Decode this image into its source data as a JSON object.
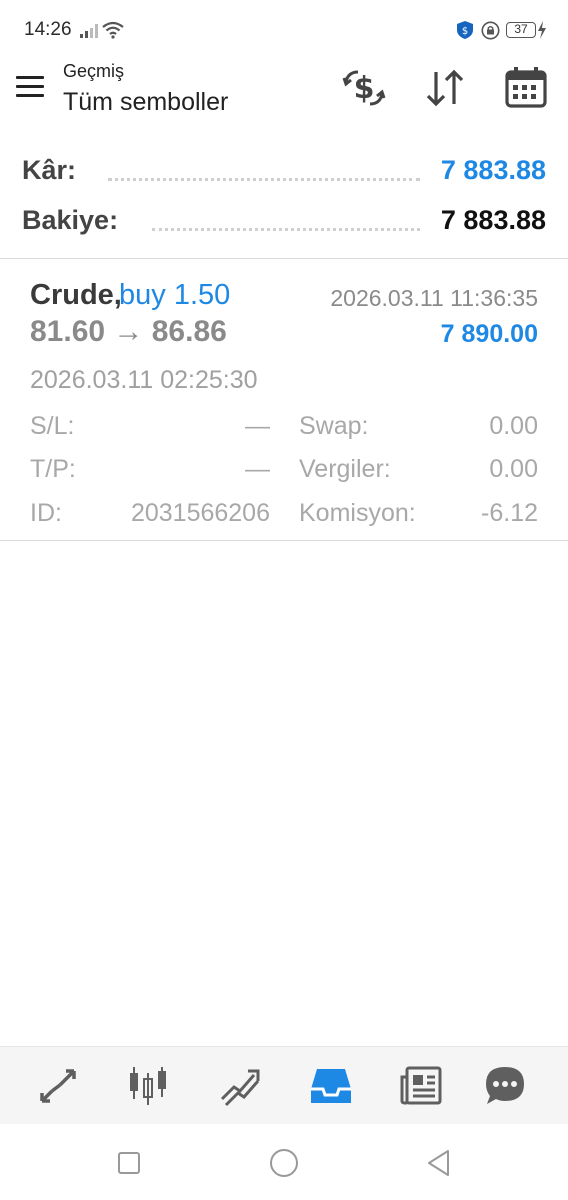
{
  "status_bar": {
    "time": "14:26",
    "battery": "37",
    "icons": [
      "signal-icon",
      "wifi-icon",
      "shield-icon",
      "lock-circle-icon",
      "battery-icon",
      "charging-bolt-icon"
    ]
  },
  "toolbar": {
    "subtitle": "Geçmiş",
    "title": "Tüm semboller",
    "icons": [
      "menu-icon",
      "dollar-exchange-icon",
      "sort-icon",
      "calendar-icon"
    ]
  },
  "summary": {
    "profit_label": "Kâr:",
    "profit_value": "7 883.88",
    "balance_label": "Bakiye:",
    "balance_value": "7 883.88"
  },
  "deal": {
    "symbol": "Crude,",
    "direction": "buy 1.50",
    "close_time": "2026.03.11 11:36:35",
    "prices": "81.60 → 86.86",
    "profit": "7 890.00",
    "open_time": "2026.03.11 02:25:30",
    "sl_label": "S/L:",
    "sl_value": "—",
    "tp_label": "T/P:",
    "tp_value": "—",
    "id_label": "ID:",
    "id_value": "2031566206",
    "swap_label": "Swap:",
    "swap_value": "0.00",
    "taxes_label": "Vergiler:",
    "taxes_value": "0.00",
    "commission_label": "Komisyon:",
    "commission_value": "-6.12"
  },
  "bottom_nav": {
    "items": [
      "quotes-icon",
      "chart-icon",
      "trade-icon",
      "history-icon",
      "news-icon",
      "chat-icon"
    ],
    "active": "history-icon"
  },
  "colors": {
    "accent": "#1e88e5",
    "label_gray": "#a8a8a8",
    "nav_gray": "#5f5f5f"
  }
}
